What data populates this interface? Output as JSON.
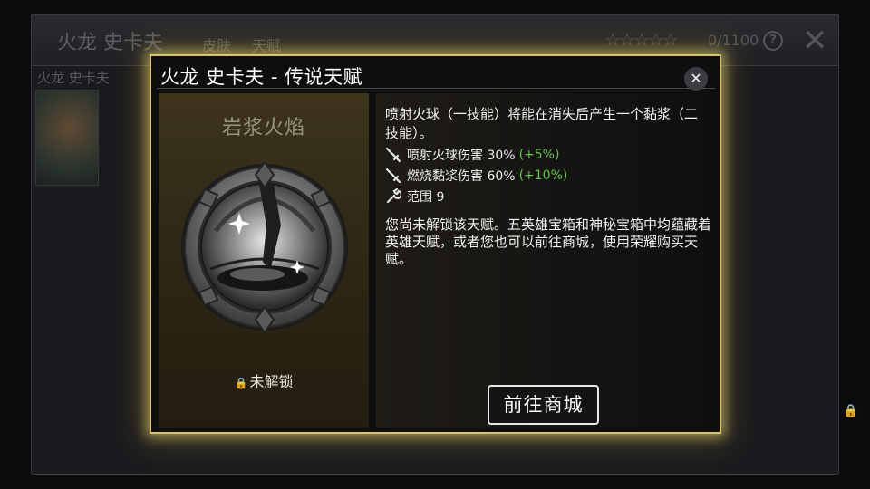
{
  "background": {
    "title": "火龙 史卡夫",
    "tabs": [
      {
        "label": "皮肤"
      },
      {
        "label": "天赋"
      }
    ],
    "stars": "☆☆☆☆☆",
    "talent_count": "0/1100",
    "help_label": "?",
    "close_label": "✕",
    "hero_name": "火龙 史卡夫"
  },
  "modal": {
    "title": "火龙 史卡夫 - 传说天赋",
    "close_label": "✕",
    "talent_name": "岩浆火焰",
    "lock_status": "未解锁",
    "description": "喷射火球（一技能）将能在消失后产生一个黏浆（二技能）。",
    "stats": [
      {
        "icon": "sword-icon",
        "label": "喷射火球伤害 30%",
        "bonus": "(+5%)"
      },
      {
        "icon": "sword-icon",
        "label": "燃烧黏浆伤害 60%",
        "bonus": "(+10%)"
      },
      {
        "icon": "wrench-icon",
        "label": "范围 9",
        "bonus": ""
      }
    ],
    "unlock_text": "您尚未解锁该天赋。五英雄宝箱和神秘宝箱中均蕴藏着英雄天赋，或者您也可以前往商城，使用荣耀购买天赋。",
    "store_button": "前往商城"
  },
  "colors": {
    "modal_border": "#d9c46a",
    "bonus_green": "#62c24a",
    "panel_gold": "#3e341c"
  }
}
